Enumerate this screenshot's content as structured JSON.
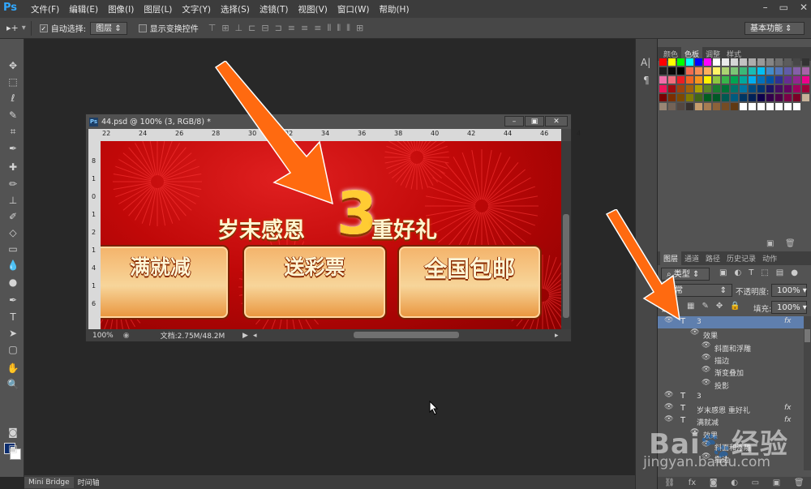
{
  "app": {
    "logo": "Ps"
  },
  "menu": [
    "文件(F)",
    "编辑(E)",
    "图像(I)",
    "图层(L)",
    "文字(Y)",
    "选择(S)",
    "滤镜(T)",
    "视图(V)",
    "窗口(W)",
    "帮助(H)"
  ],
  "options": {
    "auto_select_label": "自动选择:",
    "auto_select_value": "图层",
    "show_transform_label": "显示变换控件",
    "workspace": "基本功能"
  },
  "document": {
    "title": "44.psd @ 100% (3, RGB/8) *",
    "zoom": "100%",
    "doc_info": "文档:2.75M/48.2M",
    "ruler_h": [
      "22",
      "24",
      "26",
      "28",
      "30",
      "32",
      "34",
      "36",
      "38",
      "40",
      "42",
      "44",
      "46",
      "4"
    ],
    "ruler_v": [
      "8",
      "1",
      "0",
      "1",
      "2",
      "1",
      "4",
      "1",
      "6"
    ]
  },
  "canvas": {
    "headline_left": "岁末感恩",
    "number": "3",
    "headline_right": "重好礼",
    "buttons": [
      "满就减",
      "送彩票",
      "全国包邮"
    ]
  },
  "panels": {
    "top_tabs": [
      "颜色",
      "色板",
      "调整",
      "样式"
    ],
    "active_top_tab": "色板",
    "layer_tabs": [
      "图层",
      "通道",
      "路径",
      "历史记录",
      "动作"
    ],
    "kind_label": "类型",
    "blend_mode": "正常",
    "opacity_label": "不透明度:",
    "opacity_value": "100%",
    "lock_label": "锁定:",
    "fill_label": "填充:",
    "fill_value": "100%",
    "layers": [
      {
        "name": "3",
        "fx": "fx",
        "selected": true
      },
      {
        "name": "效果",
        "indent": 1
      },
      {
        "name": "斜面和浮雕",
        "indent": 2
      },
      {
        "name": "描边",
        "indent": 2
      },
      {
        "name": "渐变叠加",
        "indent": 2
      },
      {
        "name": "投影",
        "indent": 2
      },
      {
        "name": "3"
      },
      {
        "name": "岁末感恩    重好礼",
        "fx": "fx"
      },
      {
        "name": "满就减",
        "fx": "fx"
      },
      {
        "name": "效果",
        "indent": 1
      },
      {
        "name": "斜面和浮雕",
        "indent": 2
      },
      {
        "name": "描边",
        "indent": 2
      }
    ]
  },
  "bottom_tabs": [
    "Mini Bridge",
    "时间轴"
  ],
  "colors": {
    "swatch_palette": [
      "#ff0000",
      "#ffff00",
      "#00ff00",
      "#00ffff",
      "#0000ff",
      "#ff00ff",
      "#ffffff",
      "#ebebeb",
      "#d6d6d6",
      "#c2c2c2",
      "#adadad",
      "#999999",
      "#858585",
      "#707070",
      "#5c5c5c",
      "#474747",
      "#333333",
      "#1f1f1f",
      "#0a0a0a",
      "#000000",
      "#f26c4f",
      "#f68e55",
      "#fbaf5c",
      "#fff467",
      "#acd372",
      "#7cc576",
      "#3bb878",
      "#1abbb4",
      "#00bff3",
      "#438cca",
      "#5574b9",
      "#605ca8",
      "#855fa8",
      "#a763a8",
      "#f06eaa",
      "#f26d7d",
      "#ed1c24",
      "#f26522",
      "#f7941d",
      "#fff200",
      "#8dc73f",
      "#39b54a",
      "#00a651",
      "#00a99d",
      "#00aeef",
      "#0072bc",
      "#0054a6",
      "#2e3192",
      "#662d91",
      "#92278f",
      "#ec008c",
      "#ed145b",
      "#9e0b0f",
      "#a0410d",
      "#a3620a",
      "#aba000",
      "#598527",
      "#1a7b30",
      "#007236",
      "#00746b",
      "#0076a3",
      "#004b80",
      "#003471",
      "#1b1464",
      "#440e62",
      "#630460",
      "#9e005d",
      "#9e0039",
      "#790000",
      "#7b2e00",
      "#7d4900",
      "#827b00",
      "#406618",
      "#005e20",
      "#005826",
      "#005952",
      "#005b7f",
      "#003663",
      "#002157",
      "#0d004c",
      "#32004b",
      "#4b0049",
      "#7b0046",
      "#7a0026",
      "#c7b299",
      "#998675",
      "#736357",
      "#534741",
      "#37302d",
      "#c69c6d",
      "#a67c52",
      "#8c6239",
      "#754c24",
      "#603913",
      "#ffffff",
      "#ffffff",
      "#ffffff",
      "#ffffff",
      "#ffffff",
      "#ffffff",
      "#ffffff"
    ],
    "canvas_red": "#c00808",
    "arrow_orange": "#ff6a10"
  },
  "watermark": {
    "logo": "Bai du 经验",
    "url": "jingyan.baidu.com"
  }
}
